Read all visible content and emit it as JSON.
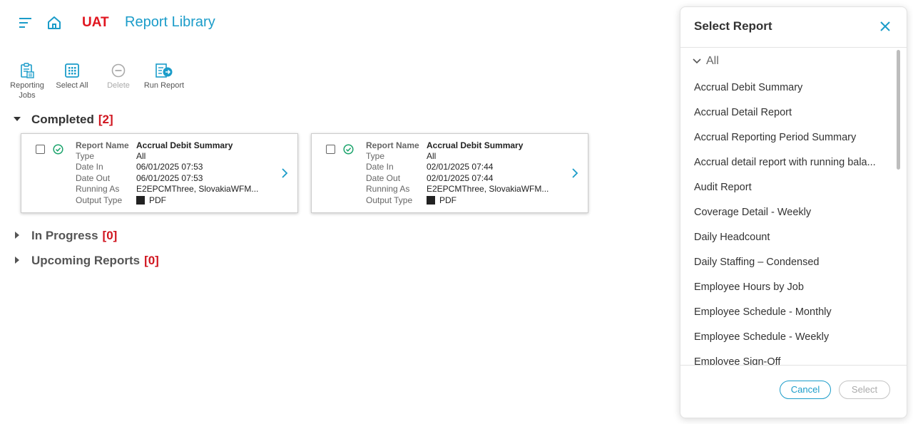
{
  "header": {
    "env_label": "UAT",
    "page_title": "Report Library",
    "menu_icon": "hamburger-icon",
    "home_icon": "home-icon"
  },
  "toolbar": {
    "reporting_jobs": "Reporting Jobs",
    "select_all": "Select All",
    "delete": "Delete",
    "run_report": "Run Report"
  },
  "sections": {
    "completed": {
      "label": "Completed",
      "count": "[2]"
    },
    "in_progress": {
      "label": "In Progress",
      "count": "[0]"
    },
    "upcoming": {
      "label": "Upcoming Reports",
      "count": "[0]"
    }
  },
  "field_labels": {
    "report_name": "Report Name",
    "type": "Type",
    "date_in": "Date In",
    "date_out": "Date Out",
    "running_as": "Running As",
    "output_type": "Output Type"
  },
  "cards": [
    {
      "report_name": "Accrual Debit Summary",
      "type": "All",
      "date_in": "06/01/2025 07:53",
      "date_out": "06/01/2025 07:53",
      "running_as": "E2EPCMThree, SlovakiaWFM...",
      "output_type": "PDF"
    },
    {
      "report_name": "Accrual Debit Summary",
      "type": "All",
      "date_in": "02/01/2025 07:44",
      "date_out": "02/01/2025 07:44",
      "running_as": "E2EPCMThree, SlovakiaWFM...",
      "output_type": "PDF"
    }
  ],
  "panel": {
    "title": "Select Report",
    "all_label": "All",
    "items": [
      "Accrual Debit Summary",
      "Accrual Detail Report",
      "Accrual Reporting Period Summary",
      "Accrual detail report with running bala...",
      "Audit Report",
      "Coverage Detail - Weekly",
      "Daily Headcount",
      "Daily Staffing – Condensed",
      "Employee Hours by Job",
      "Employee Schedule - Monthly",
      "Employee Schedule - Weekly",
      "Employee Sign-Off"
    ],
    "cancel_label": "Cancel",
    "select_label": "Select"
  },
  "colors": {
    "accent": "#1b9cc9",
    "env_red": "#e0151f",
    "count_red": "#d0151f",
    "success_green": "#1aa36b"
  }
}
